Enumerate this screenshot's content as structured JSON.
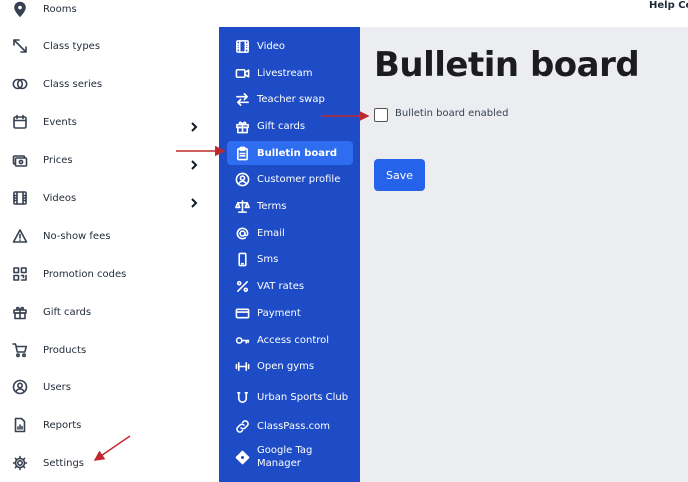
{
  "header": {
    "help_label": "Help Ce"
  },
  "sidebar": {
    "items": [
      {
        "label": "Rooms",
        "icon": "location-pin-icon",
        "chevron": false
      },
      {
        "label": "Class types",
        "icon": "resize-arrows-icon",
        "chevron": false
      },
      {
        "label": "Class series",
        "icon": "rings-icon",
        "chevron": false
      },
      {
        "label": "Events",
        "icon": "calendar-icon",
        "chevron": true
      },
      {
        "label": "Prices",
        "icon": "cash-icon",
        "chevron": true
      },
      {
        "label": "Videos",
        "icon": "film-icon",
        "chevron": true
      },
      {
        "label": "No-show fees",
        "icon": "warning-triangle-icon",
        "chevron": false
      },
      {
        "label": "Promotion codes",
        "icon": "qr-code-icon",
        "chevron": false
      },
      {
        "label": "Gift cards",
        "icon": "gift-icon",
        "chevron": false
      },
      {
        "label": "Products",
        "icon": "cart-icon",
        "chevron": false
      },
      {
        "label": "Users",
        "icon": "user-circle-icon",
        "chevron": false
      },
      {
        "label": "Reports",
        "icon": "report-icon",
        "chevron": false
      },
      {
        "label": "Settings",
        "icon": "gear-icon",
        "chevron": false
      }
    ]
  },
  "settings_menu": {
    "items": [
      {
        "label": "Video",
        "icon": "film-icon",
        "active": false
      },
      {
        "label": "Livestream",
        "icon": "video-camera-icon",
        "active": false
      },
      {
        "label": "Teacher swap",
        "icon": "swap-arrows-icon",
        "active": false
      },
      {
        "label": "Gift cards",
        "icon": "gift-icon",
        "active": false
      },
      {
        "label": "Bulletin board",
        "icon": "clipboard-icon",
        "active": true
      },
      {
        "label": "Customer profile",
        "icon": "user-circle-icon",
        "active": false
      },
      {
        "label": "Terms",
        "icon": "scales-icon",
        "active": false
      },
      {
        "label": "Email",
        "icon": "at-sign-icon",
        "active": false
      },
      {
        "label": "Sms",
        "icon": "phone-icon",
        "active": false
      },
      {
        "label": "VAT rates",
        "icon": "percent-icon",
        "active": false
      },
      {
        "label": "Payment",
        "icon": "credit-card-icon",
        "active": false
      },
      {
        "label": "Access control",
        "icon": "key-icon",
        "active": false
      },
      {
        "label": "Open gyms",
        "icon": "dumbbell-icon",
        "active": false
      },
      {
        "label": "Urban Sports Club",
        "icon": "magnet-icon",
        "active": false
      },
      {
        "label": "ClassPass.com",
        "icon": "link-icon",
        "active": false
      },
      {
        "label": "Google Tag Manager",
        "icon": "diamond-icon",
        "active": false
      }
    ]
  },
  "main": {
    "title": "Bulletin board",
    "checkbox_label": "Bulletin board enabled",
    "checkbox_checked": false,
    "save_label": "Save"
  },
  "colors": {
    "menu_bg": "#1e4cc7",
    "menu_active": "#2f6df0",
    "content_bg": "#ebedf0",
    "button": "#2563eb",
    "arrow": "#c0282d"
  }
}
